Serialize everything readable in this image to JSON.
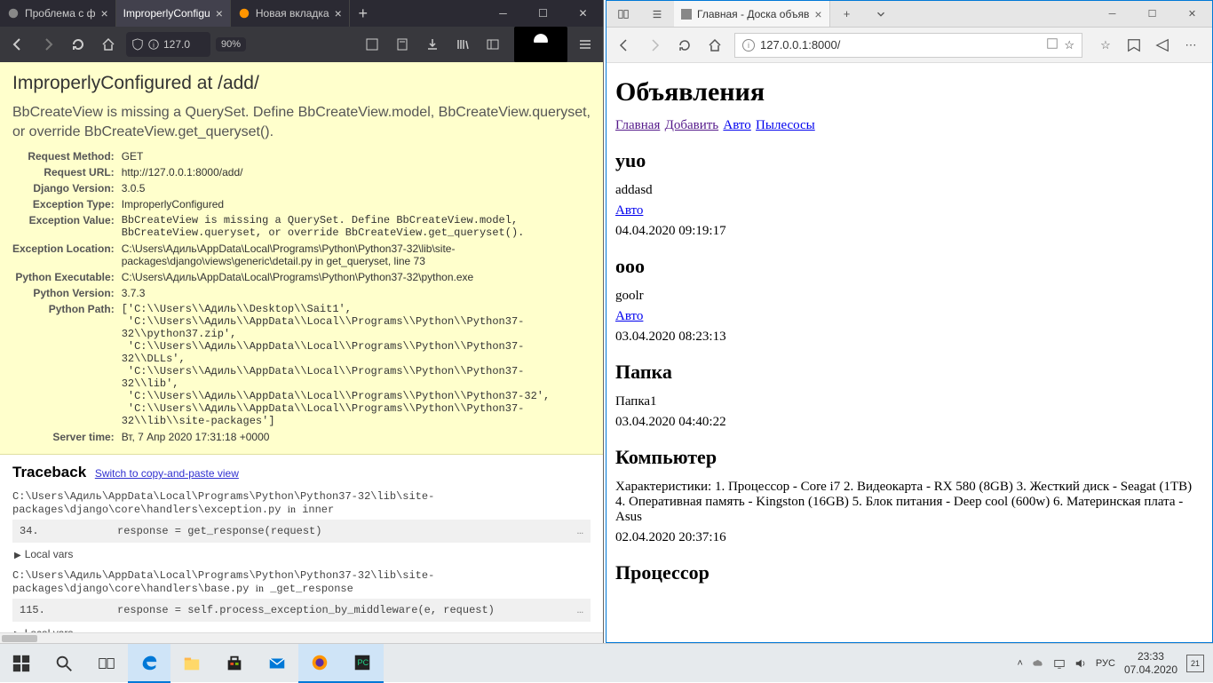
{
  "firefox": {
    "tabs": [
      {
        "label": "Проблема с ф",
        "active": false
      },
      {
        "label": "ImproperlyConfigu",
        "active": true
      },
      {
        "label": "Новая вкладка",
        "active": false
      }
    ],
    "url": "127.0",
    "zoom": "90%"
  },
  "django": {
    "title": "ImproperlyConfigured at /add/",
    "message": "BbCreateView is missing a QuerySet. Define BbCreateView.model, BbCreateView.queryset, or override BbCreateView.get_queryset().",
    "meta": {
      "request_method_k": "Request Method:",
      "request_method_v": "GET",
      "request_url_k": "Request URL:",
      "request_url_v": "http://127.0.0.1:8000/add/",
      "django_version_k": "Django Version:",
      "django_version_v": "3.0.5",
      "exception_type_k": "Exception Type:",
      "exception_type_v": "ImproperlyConfigured",
      "exception_value_k": "Exception Value:",
      "exception_value_v": "BbCreateView is missing a QuerySet. Define BbCreateView.model, BbCreateView.queryset, or override BbCreateView.get_queryset().",
      "exception_location_k": "Exception Location:",
      "exception_location_v": "C:\\Users\\Адиль\\AppData\\Local\\Programs\\Python\\Python37-32\\lib\\site-packages\\django\\views\\generic\\detail.py in get_queryset, line 73",
      "python_executable_k": "Python Executable:",
      "python_executable_v": "C:\\Users\\Адиль\\AppData\\Local\\Programs\\Python\\Python37-32\\python.exe",
      "python_version_k": "Python Version:",
      "python_version_v": "3.7.3",
      "python_path_k": "Python Path:",
      "python_path_v": "['C:\\\\Users\\\\Адиль\\\\Desktop\\\\Sait1',\n 'C:\\\\Users\\\\Адиль\\\\AppData\\\\Local\\\\Programs\\\\Python\\\\Python37-32\\\\python37.zip',\n 'C:\\\\Users\\\\Адиль\\\\AppData\\\\Local\\\\Programs\\\\Python\\\\Python37-32\\\\DLLs',\n 'C:\\\\Users\\\\Адиль\\\\AppData\\\\Local\\\\Programs\\\\Python\\\\Python37-32\\\\lib',\n 'C:\\\\Users\\\\Адиль\\\\AppData\\\\Local\\\\Programs\\\\Python\\\\Python37-32',\n 'C:\\\\Users\\\\Адиль\\\\AppData\\\\Local\\\\Programs\\\\Python\\\\Python37-32\\\\lib\\\\site-packages']",
      "server_time_k": "Server time:",
      "server_time_v": "Вт, 7 Апр 2020 17:31:18 +0000"
    },
    "traceback_heading": "Traceback",
    "switch_link": "Switch to copy-and-paste view",
    "frames": [
      {
        "file": "C:\\Users\\Адиль\\AppData\\Local\\Programs\\Python\\Python37-32\\lib\\site-packages\\django\\core\\handlers\\exception.py",
        "in": "inner",
        "line_no": "34.",
        "src": "response = get_response(request)",
        "local_vars": "Local vars"
      },
      {
        "file": "C:\\Users\\Адиль\\AppData\\Local\\Programs\\Python\\Python37-32\\lib\\site-packages\\django\\core\\handlers\\base.py",
        "in": "_get_response",
        "line_no": "115.",
        "src": "response = self.process_exception_by_middleware(e, request)",
        "local_vars": "Local vars"
      }
    ]
  },
  "edge": {
    "tab_title": "Главная - Доска объяв",
    "url": "127.0.0.1:8000/",
    "page_title": "Объявления",
    "nav": [
      {
        "label": "Главная",
        "visited": true
      },
      {
        "label": "Добавить",
        "visited": true
      },
      {
        "label": "Авто",
        "visited": false
      },
      {
        "label": "Пылесосы",
        "visited": false
      }
    ],
    "posts": [
      {
        "title": "yuo",
        "body": "addasd",
        "cat": "Авто",
        "date": "04.04.2020 09:19:17"
      },
      {
        "title": "ooo",
        "body": "goolr",
        "cat": "Авто",
        "date": "03.04.2020 08:23:13"
      },
      {
        "title": "Папка",
        "body": "Папка1",
        "cat": "",
        "date": "03.04.2020 04:40:22"
      },
      {
        "title": "Компьютер",
        "body": "Характеристики: 1. Процессор - Core i7 2. Видеокарта - RX 580 (8GB) 3. Жесткий диск - Seagat (1TB) 4. Оперативная память - Kingston (16GB) 5. Блок питания - Deep cool (600w) 6. Материнская плата - Asus",
        "cat": "",
        "date": "02.04.2020 20:37:16"
      },
      {
        "title": "Процессор",
        "body": "",
        "cat": "",
        "date": ""
      }
    ]
  },
  "taskbar": {
    "lang": "РУС",
    "time": "23:33",
    "date": "07.04.2020",
    "notif_count": "21"
  }
}
